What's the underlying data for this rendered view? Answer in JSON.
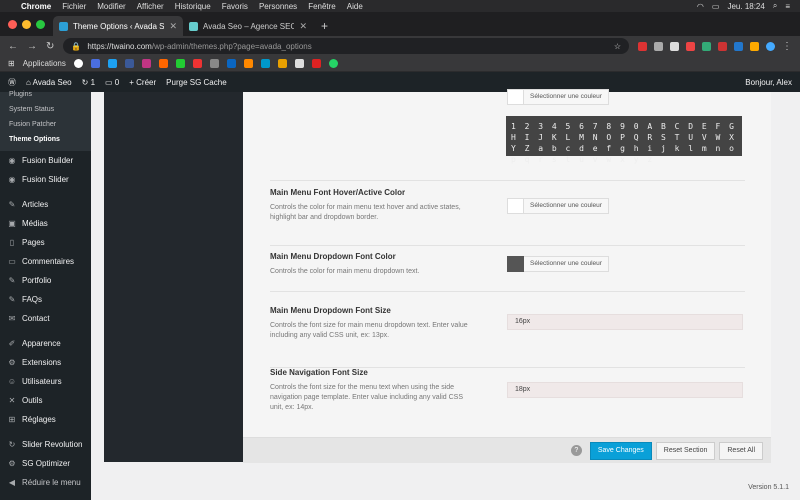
{
  "mac_menu": {
    "items": [
      "Chrome",
      "Fichier",
      "Modifier",
      "Afficher",
      "Historique",
      "Favoris",
      "Personnes",
      "Fenêtre",
      "Aide"
    ],
    "clock": "Jeu. 18:24"
  },
  "browser": {
    "tabs": [
      {
        "title": "Theme Options ‹ Avada Seo —",
        "active": true
      },
      {
        "title": "Avada Seo – Agence SEO",
        "active": false
      }
    ],
    "url_host": "https://twaino.com",
    "url_path": "/wp-admin/themes.php?page=avada_options",
    "bookmarks_label": "Applications"
  },
  "wp_admin_bar": {
    "site_name": "Avada Seo",
    "updates_count": "1",
    "comments_count": "0",
    "new_label": "Créer",
    "purge_label": "Purge SG Cache",
    "greeting": "Bonjour, Alex"
  },
  "sidebar": {
    "submenu": [
      {
        "label": "Plugins",
        "current": false
      },
      {
        "label": "System Status",
        "current": false
      },
      {
        "label": "Fusion Patcher",
        "current": false
      },
      {
        "label": "Theme Options",
        "current": true
      }
    ],
    "group1": [
      {
        "label": "Fusion Builder",
        "icon": "fusion-builder-icon"
      },
      {
        "label": "Fusion Slider",
        "icon": "fusion-slider-icon"
      }
    ],
    "group2": [
      {
        "label": "Articles",
        "icon": "pin-icon"
      },
      {
        "label": "Médias",
        "icon": "media-icon"
      },
      {
        "label": "Pages",
        "icon": "page-icon"
      },
      {
        "label": "Commentaires",
        "icon": "comment-icon"
      },
      {
        "label": "Portfolio",
        "icon": "pin-icon"
      },
      {
        "label": "FAQs",
        "icon": "pin-icon"
      },
      {
        "label": "Contact",
        "icon": "mail-icon"
      }
    ],
    "group3": [
      {
        "label": "Apparence",
        "icon": "brush-icon"
      },
      {
        "label": "Extensions",
        "icon": "plugin-icon"
      },
      {
        "label": "Utilisateurs",
        "icon": "users-icon"
      },
      {
        "label": "Outils",
        "icon": "wrench-icon"
      },
      {
        "label": "Réglages",
        "icon": "settings-icon"
      }
    ],
    "group4": [
      {
        "label": "Slider Revolution",
        "icon": "refresh-icon"
      },
      {
        "label": "SG Optimizer",
        "icon": "gear-icon"
      },
      {
        "label": "Réduire le menu",
        "icon": "collapse-icon"
      }
    ]
  },
  "options": {
    "select_color_label": "Sélectionner une couleur",
    "font_preview": "1 2 3 4 5 6 7 8 9 0 A B C D E F G H I J K L M N O P Q R S T U V W X Y Z a b c d e f g h i j k l m n o p q r s t u v w x y z",
    "hover_title": "Main Menu Font Hover/Active Color",
    "hover_desc": "Controls the color for main menu text hover and active states, highlight bar and dropdown border.",
    "dropdown_color_title": "Main Menu Dropdown Font Color",
    "dropdown_color_desc": "Controls the color for main menu dropdown text.",
    "dropdown_size_title": "Main Menu Dropdown Font Size",
    "dropdown_size_desc": "Controls the font size for main menu dropdown text. Enter value including any valid CSS unit, ex: 13px.",
    "dropdown_size_value": "16px",
    "sidenav_title": "Side Navigation Font Size",
    "sidenav_desc": "Controls the font size for the menu text when using the side navigation page template. Enter value including any valid CSS unit, ex: 14px.",
    "sidenav_value": "18px"
  },
  "footer": {
    "help": "?",
    "save": "Save Changes",
    "reset_section": "Reset Section",
    "reset_all": "Reset All",
    "version": "Version 5.1.1"
  }
}
